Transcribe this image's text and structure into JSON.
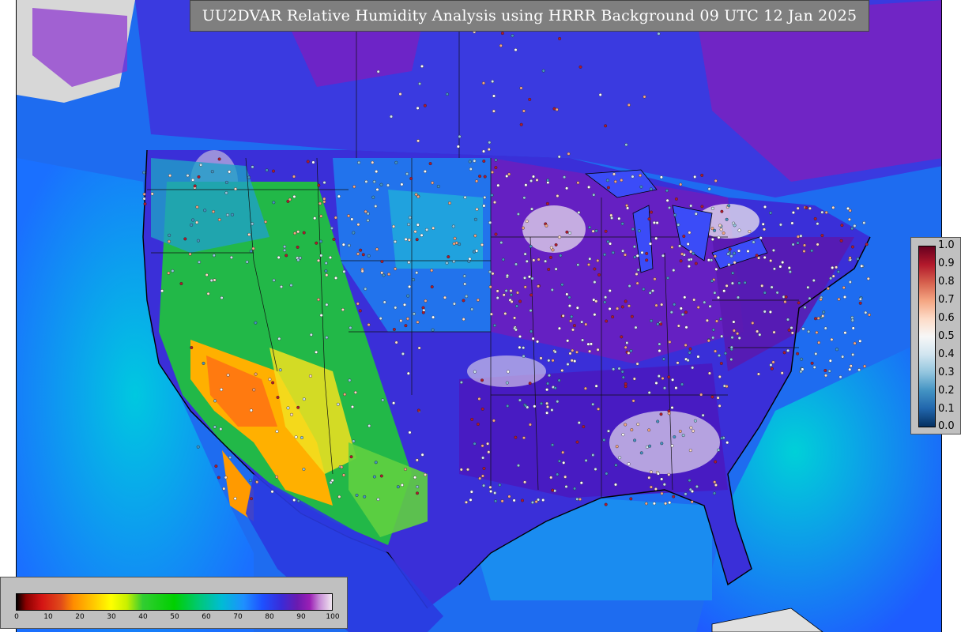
{
  "title": "UU2DVAR Relative Humidity Analysis using HRRR Background 09 UTC 12 Jan 2025",
  "legend_right": {
    "ticks": [
      "1.0",
      "0.9",
      "0.8",
      "0.7",
      "0.6",
      "0.5",
      "0.4",
      "0.3",
      "0.2",
      "0.1",
      "0.0"
    ]
  },
  "legend_bottom": {
    "ticks": [
      "0",
      "10",
      "20",
      "30",
      "40",
      "50",
      "60",
      "70",
      "80",
      "90",
      "100"
    ]
  },
  "colors": {
    "ocean": "#1f6fe0",
    "humid": "#5a1fb0",
    "dry": "#ff9a00",
    "moderate": "#22c020",
    "saturated": "#e8e0ee"
  }
}
